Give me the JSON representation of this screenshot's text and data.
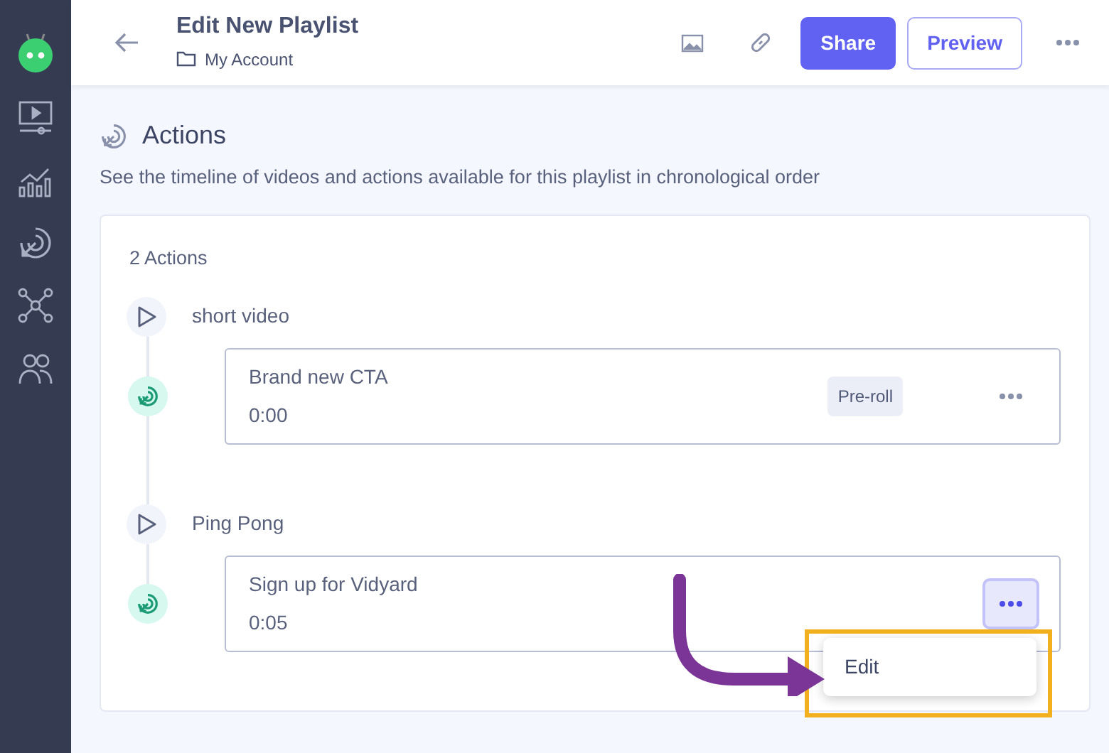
{
  "header": {
    "title": "Edit New Playlist",
    "folder": "My Account",
    "share": "Share",
    "preview": "Preview"
  },
  "section": {
    "title": "Actions",
    "description": "See the timeline of videos and actions available for this playlist in chronological order"
  },
  "count": "2 Actions",
  "videos": [
    {
      "name": "short video",
      "actions": [
        {
          "name": "Brand new CTA",
          "time": "0:00",
          "tag": "Pre-roll",
          "menu_open": false
        }
      ]
    },
    {
      "name": "Ping Pong",
      "actions": [
        {
          "name": "Sign up for Vidyard",
          "time": "0:05",
          "menu_open": true,
          "menu": [
            "Edit"
          ]
        }
      ]
    }
  ]
}
